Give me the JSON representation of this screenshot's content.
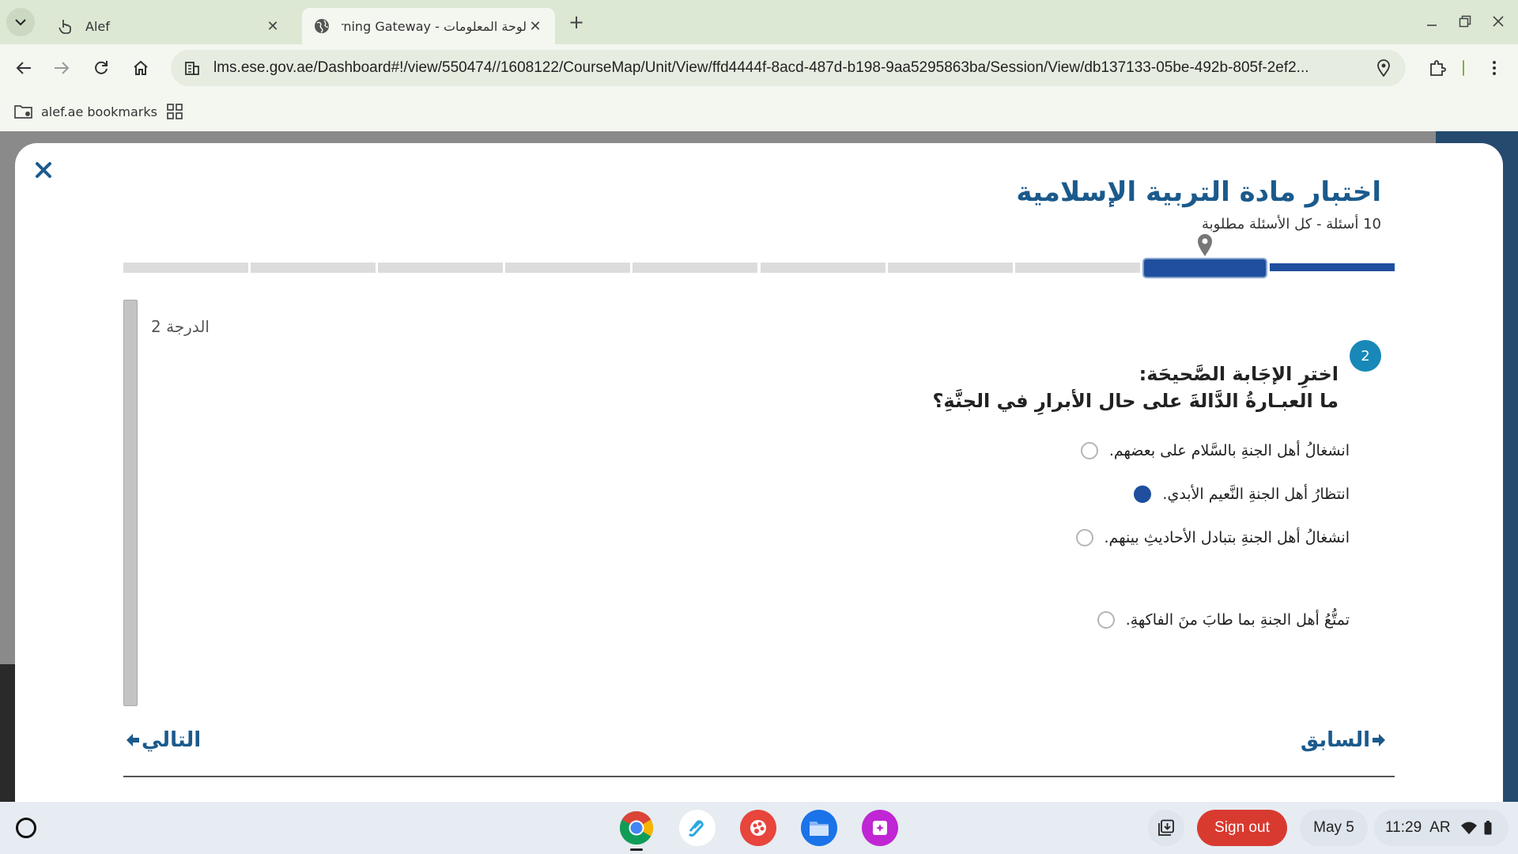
{
  "browser": {
    "tabs": [
      {
        "title": "Alef",
        "icon": "hand-pointer-icon"
      },
      {
        "title": "لوحة المعلومات - Learning Gateway",
        "icon": "globe-icon",
        "active": true
      }
    ],
    "url": "lms.ese.gov.ae/Dashboard#!/view/550474//1608122/CourseMap/Unit/View/ffd4444f-8acd-487d-b198-9aa5295863ba/Session/View/db137133-05be-492b-805f-2ef2...",
    "bookmark_folder": "alef.ae bookmarks"
  },
  "quiz": {
    "title": "اختبار مادة التربية الإسلامية",
    "subtitle": "10 أسئلة - كل الأسئلة مطلوبة",
    "progress": {
      "total": 10,
      "completed": 1,
      "current": 2
    },
    "score_label": "الدرجة 2",
    "question": {
      "number": "2",
      "line1": "اخترِ الإجَابة الصَّحيحَة:",
      "line2": "ما العبـارةُ الدَّالةَ على حال الأبرارِ في الجنَّةِ؟",
      "options": [
        {
          "text": "انشغالُ أهل الجنةِ بالسَّلام على بعضهم.",
          "selected": false
        },
        {
          "text": "انتظارُ أهل الجنةِ النَّعيم الأبدي.",
          "selected": true
        },
        {
          "text": "انشغالُ أهل الجنةِ بتبادل الأحاديثِ بينهم.",
          "selected": false
        },
        {
          "text": "تمتُّعُ أهل الجنةِ بما طابَ منَ الفاكهةِ.",
          "selected": false
        }
      ]
    },
    "next_label": "التالي",
    "prev_label": "السابق"
  },
  "shelf": {
    "apps": [
      "chrome-icon",
      "link-app-icon",
      "canvas-app-icon",
      "files-icon",
      "gallery-app-icon"
    ],
    "sign_out": "Sign out",
    "date": "May 5",
    "time": "11:29",
    "ime": "AR"
  },
  "colors": {
    "accent": "#1b5a8c",
    "progress_fill": "#1f4f9e",
    "badge": "#1788b8",
    "sign_out": "#d93a30"
  }
}
